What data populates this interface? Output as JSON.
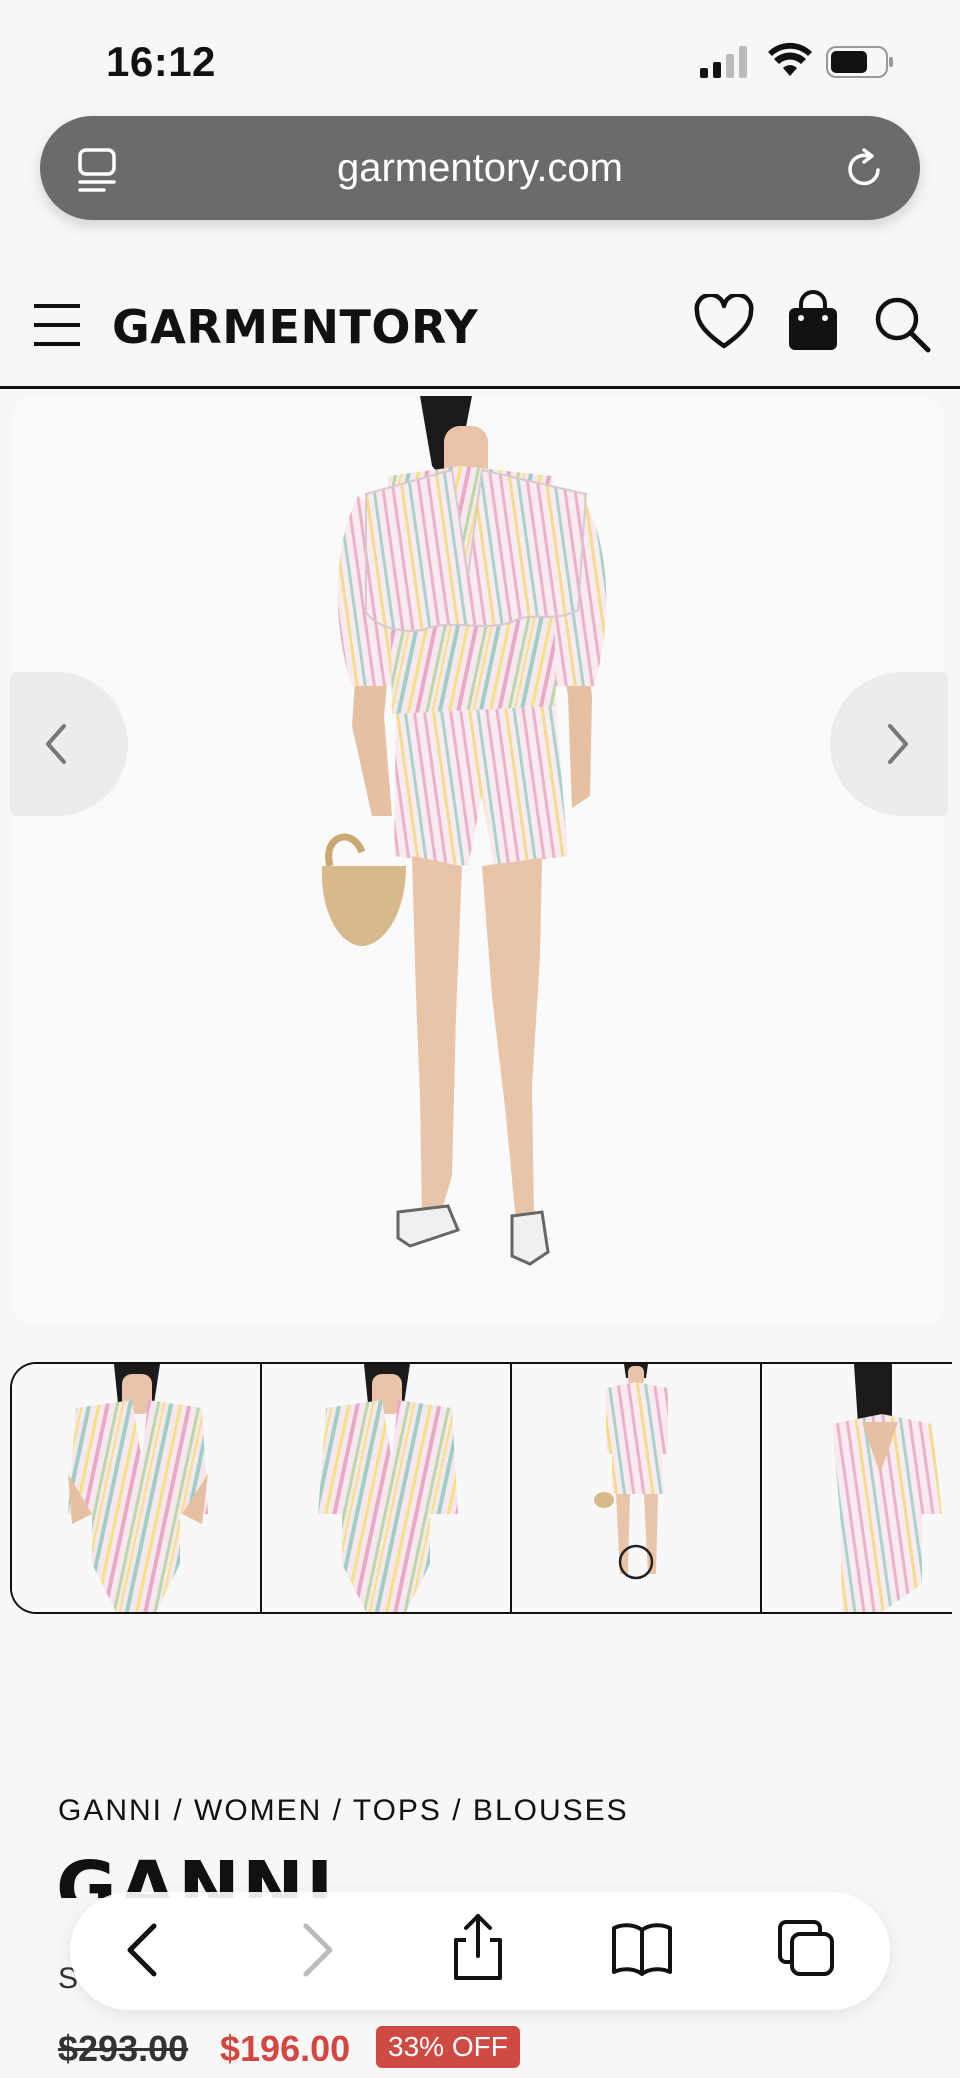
{
  "status": {
    "time": "16:12"
  },
  "browser": {
    "url": "garmentory.com"
  },
  "site": {
    "logo": "GARMENTORY"
  },
  "product": {
    "breadcrumb": "GANNI / WOMEN / TOPS / BLOUSES",
    "brand": "GANNI",
    "title_partial": "S",
    "old_price": "$293.00",
    "new_price": "$196.00",
    "discount": "33% OFF"
  },
  "colors": {
    "sale": "#d2473f",
    "urlbar": "#6b6b6b"
  },
  "icons": [
    "tabs-icon",
    "reload-icon",
    "menu-icon",
    "heart-icon",
    "bag-icon",
    "search-icon",
    "chevron-left-icon",
    "chevron-right-icon",
    "back-icon",
    "forward-icon",
    "share-icon",
    "bookmarks-icon",
    "tabs-overview-icon"
  ]
}
